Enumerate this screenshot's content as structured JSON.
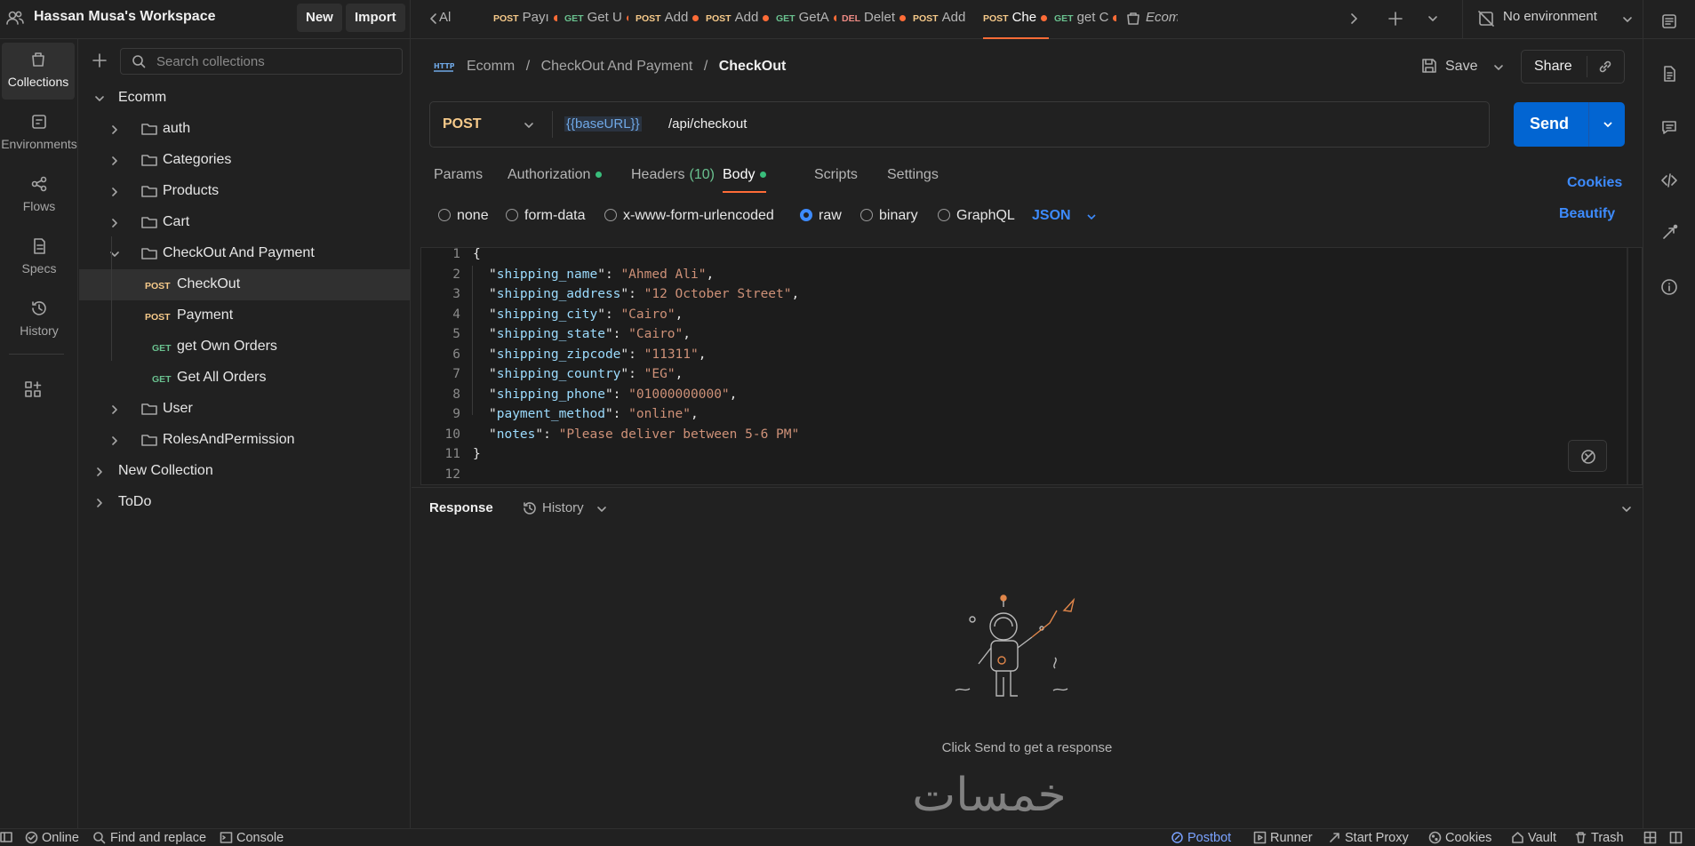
{
  "workspace": {
    "name": "Hassan Musa's Workspace",
    "new_label": "New",
    "import_label": "Import"
  },
  "tabs": [
    {
      "method": "",
      "label": "Al",
      "dot": false
    },
    {
      "method": "POST",
      "label": "Payı",
      "dot": true
    },
    {
      "method": "GET",
      "label": "Get U",
      "dot": true
    },
    {
      "method": "POST",
      "label": "Add",
      "dot": true
    },
    {
      "method": "POST",
      "label": "Add",
      "dot": true
    },
    {
      "method": "GET",
      "label": "GetA",
      "dot": true
    },
    {
      "method": "DEL",
      "label": "Delet",
      "dot": true
    },
    {
      "method": "POST",
      "label": "Add",
      "dot": false
    },
    {
      "method": "POST",
      "label": "Che",
      "dot": true,
      "active": true
    },
    {
      "method": "GET",
      "label": "get C",
      "dot": true
    },
    {
      "method": "",
      "label": "Ecomı",
      "dot": false
    }
  ],
  "environment": {
    "label": "No environment"
  },
  "rail": [
    {
      "label": "Collections",
      "icon": "collections-icon",
      "active": true
    },
    {
      "label": "Environments",
      "icon": "environments-icon"
    },
    {
      "label": "Flows",
      "icon": "flows-icon"
    },
    {
      "label": "Specs",
      "icon": "specs-icon"
    },
    {
      "label": "History",
      "icon": "history-icon"
    }
  ],
  "sidebar": {
    "search_placeholder": "Search collections",
    "tree": [
      {
        "label": "Ecomm",
        "level": 0,
        "type": "collection",
        "expanded": true
      },
      {
        "label": "auth",
        "level": 1,
        "type": "folder"
      },
      {
        "label": "Categories",
        "level": 1,
        "type": "folder"
      },
      {
        "label": "Products",
        "level": 1,
        "type": "folder"
      },
      {
        "label": "Cart",
        "level": 1,
        "type": "folder"
      },
      {
        "label": "CheckOut And Payment",
        "level": 1,
        "type": "folder",
        "expanded": true
      },
      {
        "label": "CheckOut",
        "level": 2,
        "type": "request",
        "method": "POST",
        "selected": true
      },
      {
        "label": "Payment",
        "level": 2,
        "type": "request",
        "method": "POST"
      },
      {
        "label": "get Own Orders",
        "level": 2,
        "type": "request",
        "method": "GET"
      },
      {
        "label": "Get All Orders",
        "level": 2,
        "type": "request",
        "method": "GET"
      },
      {
        "label": "User",
        "level": 1,
        "type": "folder"
      },
      {
        "label": "RolesAndPermission",
        "level": 1,
        "type": "folder"
      },
      {
        "label": "New Collection",
        "level": 0,
        "type": "collection"
      },
      {
        "label": "ToDo",
        "level": 0,
        "type": "collection"
      }
    ]
  },
  "request": {
    "breadcrumb": [
      "Ecomm",
      "CheckOut And Payment",
      "CheckOut"
    ],
    "save_label": "Save",
    "share_label": "Share",
    "method": "POST",
    "url_var": "{{baseURL}}",
    "url_path": "/api/checkout",
    "send_label": "Send",
    "tabs": [
      {
        "label": "Params"
      },
      {
        "label": "Authorization",
        "dot": true
      },
      {
        "label": "Headers",
        "count": "(10)"
      },
      {
        "label": "Body",
        "dot": true,
        "active": true
      },
      {
        "label": "Scripts"
      },
      {
        "label": "Settings"
      }
    ],
    "cookies_label": "Cookies",
    "beautify_label": "Beautify",
    "body_types": [
      {
        "label": "none"
      },
      {
        "label": "form-data"
      },
      {
        "label": "x-www-form-urlencoded"
      },
      {
        "label": "raw",
        "checked": true
      },
      {
        "label": "binary"
      },
      {
        "label": "GraphQL"
      }
    ],
    "format": "JSON",
    "body_lines": [
      {
        "n": "1",
        "key": "",
        "val": "",
        "text": "{"
      },
      {
        "n": "2",
        "key": "shipping_name",
        "val": "Ahmed Ali"
      },
      {
        "n": "3",
        "key": "shipping_address",
        "val": "12 October Street"
      },
      {
        "n": "4",
        "key": "shipping_city",
        "val": "Cairo"
      },
      {
        "n": "5",
        "key": "shipping_state",
        "val": "Cairo"
      },
      {
        "n": "6",
        "key": "shipping_zipcode",
        "val": "11311"
      },
      {
        "n": "7",
        "key": "shipping_country",
        "val": "EG"
      },
      {
        "n": "8",
        "key": "shipping_phone",
        "val": "01000000000"
      },
      {
        "n": "9",
        "key": "payment_method",
        "val": "online"
      },
      {
        "n": "10",
        "key": "notes",
        "val": "Please deliver between 5-6 PM",
        "last": true
      },
      {
        "n": "11",
        "key": "",
        "val": "",
        "text": "}"
      },
      {
        "n": "12",
        "key": "",
        "val": "",
        "text": ""
      }
    ]
  },
  "response": {
    "title": "Response",
    "history_label": "History",
    "empty_text": "Click Send to get a response"
  },
  "watermark": "خمسات",
  "statusbar": {
    "online": "Online",
    "find_replace": "Find and replace",
    "console": "Console",
    "postbot": "Postbot",
    "runner": "Runner",
    "proxy": "Start Proxy",
    "cookies": "Cookies",
    "vault": "Vault",
    "trash": "Trash"
  },
  "colors": {
    "accent": "#ff6c37",
    "send": "#0265d2",
    "post": "#f7ca8a",
    "get": "#6ac18f",
    "delete": "#ed8a84",
    "link": "#3d8bfd"
  }
}
